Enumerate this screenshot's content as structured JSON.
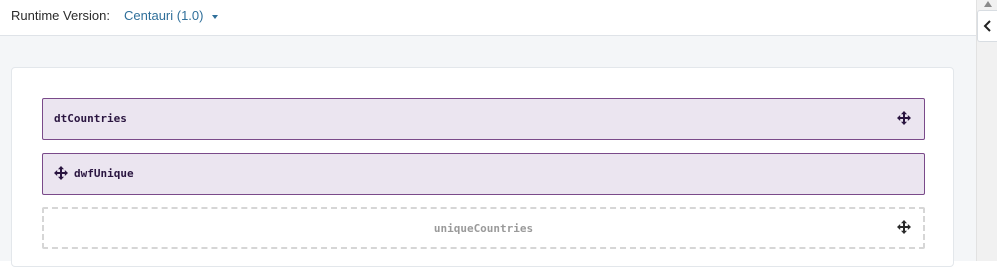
{
  "header": {
    "runtime_label": "Runtime Version:",
    "runtime_value": "Centauri (1.0)"
  },
  "blocks": [
    {
      "name": "dtCountries",
      "style": "solid",
      "icon": "move-icon",
      "icon_side": "right"
    },
    {
      "name": "dwfUnique",
      "style": "solid",
      "icon": "move-icon",
      "icon_side": "left"
    },
    {
      "name": "uniqueCountries",
      "style": "dashed",
      "icon": "move-icon",
      "icon_side": "right"
    }
  ],
  "sidebar": {
    "toggle_icon": "chevron-left-icon",
    "scroll_icon": "scroll-up-arrow-icon"
  },
  "colors": {
    "block_fill": "#ebe5f0",
    "block_border": "#7a4a8a",
    "link": "#2f6f9a",
    "canvas": "#f4f6f8"
  }
}
